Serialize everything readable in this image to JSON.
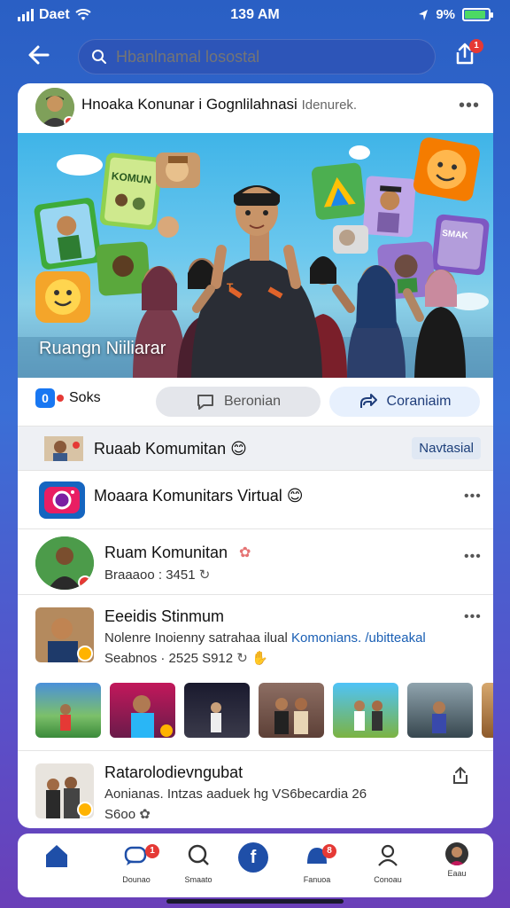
{
  "status_bar": {
    "carrier": "Daet",
    "time": "139 AM",
    "battery": "9%",
    "battery_level": 0.9
  },
  "search": {
    "placeholder": "Hbanlnamal losostal"
  },
  "header_badge": "1",
  "post": {
    "title": "Hnoaka Konunar i Gognlilahnasi",
    "subtitle": "Idenurek.",
    "banner_caption": "Ruangn Niiliarar",
    "banner_cards": [
      "KOMUN",
      "SMAK"
    ],
    "banner_card_t": "T"
  },
  "actions": {
    "sozluk_badge": "0",
    "sozluk": "Soks",
    "comment": "Beronian",
    "share": "Coraniaim"
  },
  "notification": {
    "label": "Ruaab Komumitan",
    "emoji": "😊",
    "tag": "Navtasial"
  },
  "feed": [
    {
      "title": "Moaara Komunitars Virtual",
      "emoji": "😊"
    },
    {
      "title": "Ruam Komunitan",
      "sub": "Braaaoo : 3451"
    },
    {
      "title": "Eeeidis Stinmum",
      "line1_a": "Nolenre Inoienny satrahaa ilual",
      "line1_b": "Komonians. /ubitteakal",
      "line2": "Seabnos · 2525 S912"
    },
    {
      "title": "Ratarolodievngubat",
      "line1": "Aonianas. Intzas aaduek hg VS6becardia 26",
      "line2": "S6oo"
    }
  ],
  "nav": [
    {
      "label": "",
      "icon": "home-icon"
    },
    {
      "label": "Dounao",
      "icon": "chat-icon",
      "badge": "1"
    },
    {
      "label": "Smaato",
      "icon": "search-icon"
    },
    {
      "label": "",
      "icon": "facebook-logo"
    },
    {
      "label": "Fanuoa",
      "icon": "groups-icon",
      "badge": "8"
    },
    {
      "label": "Conoau",
      "icon": "profile-icon"
    },
    {
      "label": "Eaau",
      "icon": "avatar"
    }
  ],
  "colors": {
    "primary": "#1877f2",
    "background_top": "#2a5fc4",
    "background_bottom": "#6a3fb8",
    "badge": "#e53935"
  }
}
